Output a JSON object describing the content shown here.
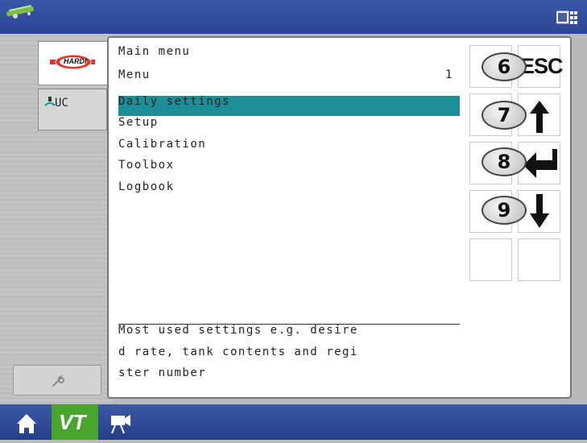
{
  "main": {
    "title": "Main menu",
    "subtitle": "Menu",
    "page_number": "1",
    "items": [
      {
        "label": "Daily settings",
        "selected": true
      },
      {
        "label": "Setup"
      },
      {
        "label": "Calibration"
      },
      {
        "label": "Toolbox"
      },
      {
        "label": "Logbook"
      }
    ],
    "description_lines": [
      "Most used settings e.g. desire",
      "d rate, tank contents and regi",
      "ster number"
    ]
  },
  "left_tabs": {
    "hardi_logo_text": "HARDI",
    "uc_label": "UC"
  },
  "softkeys": {
    "numbers": [
      "6",
      "7",
      "8",
      "9"
    ],
    "esc_label": "ESC",
    "icons": [
      "esc",
      "arrow-up-icon",
      "enter-icon",
      "arrow-down-icon"
    ]
  },
  "bottom_bar": {
    "vt_label": "VT",
    "icons": [
      "home-icon",
      "vt-icon",
      "camera-icon"
    ]
  },
  "colors": {
    "selection": "#1b8f95",
    "top_bar": "#2a4593",
    "vt_button": "#4aa52e"
  }
}
